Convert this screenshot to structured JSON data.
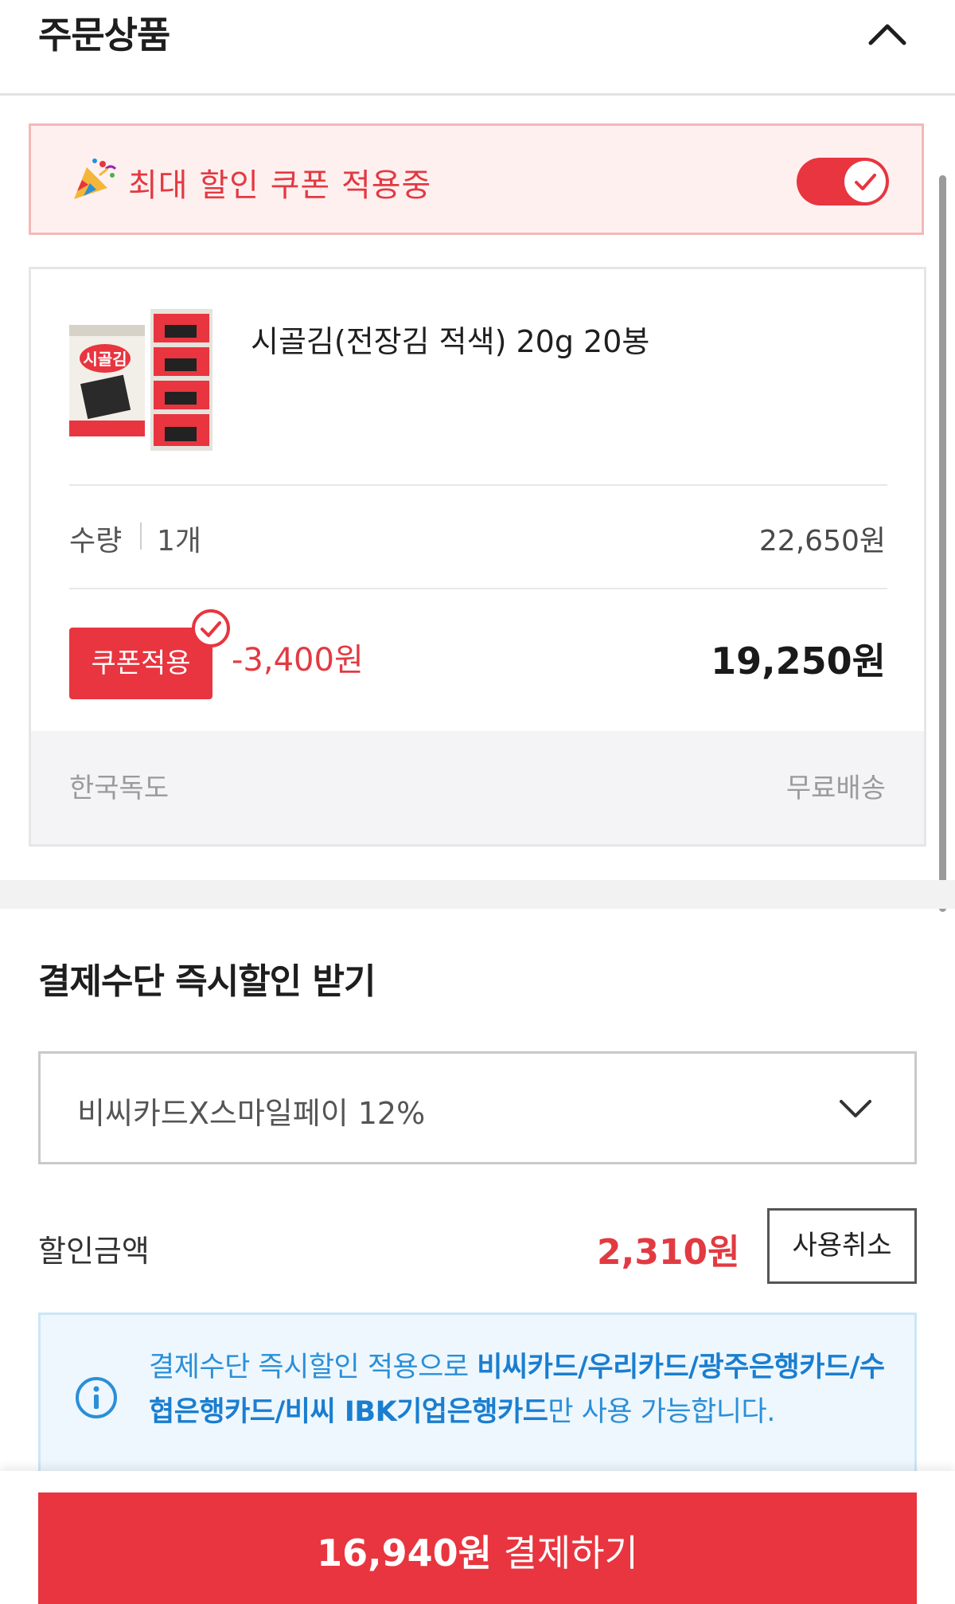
{
  "header": {
    "title": "주문상품"
  },
  "coupon_banner": {
    "text": "최대 할인 쿠폰 적용중",
    "toggle_on": true
  },
  "product": {
    "name": "시골김(전장김 적색) 20g 20봉",
    "quantity_label": "수량",
    "quantity_value": "1개",
    "original_price": "22,650원",
    "coupon_button": "쿠폰적용",
    "discount": "-3,400원",
    "final_price": "19,250원",
    "ship_origin": "한국독도",
    "ship_fee": "무료배송"
  },
  "payment": {
    "title": "결제수단 즉시할인 받기",
    "selected_method": "비씨카드X스마일페이 12%",
    "discount_label": "할인금액",
    "discount_amount": "2,310원",
    "cancel_button": "사용취소",
    "info_prefix": "결제수단 즉시할인 적용으로 ",
    "info_cards": "비씨카드/우리카드/광주은행카드/수협은행카드/비씨 IBK기업은행카드",
    "info_suffix": "만 사용 가능합니다."
  },
  "checkout": {
    "amount": "16,940원",
    "label": " 결제하기"
  },
  "colors": {
    "accent": "#e8353f",
    "info_blue": "#2a8fd8"
  },
  "icons": [
    "chevron-up-icon",
    "party-popper-icon",
    "check-icon",
    "chevron-down-icon",
    "info-icon"
  ]
}
